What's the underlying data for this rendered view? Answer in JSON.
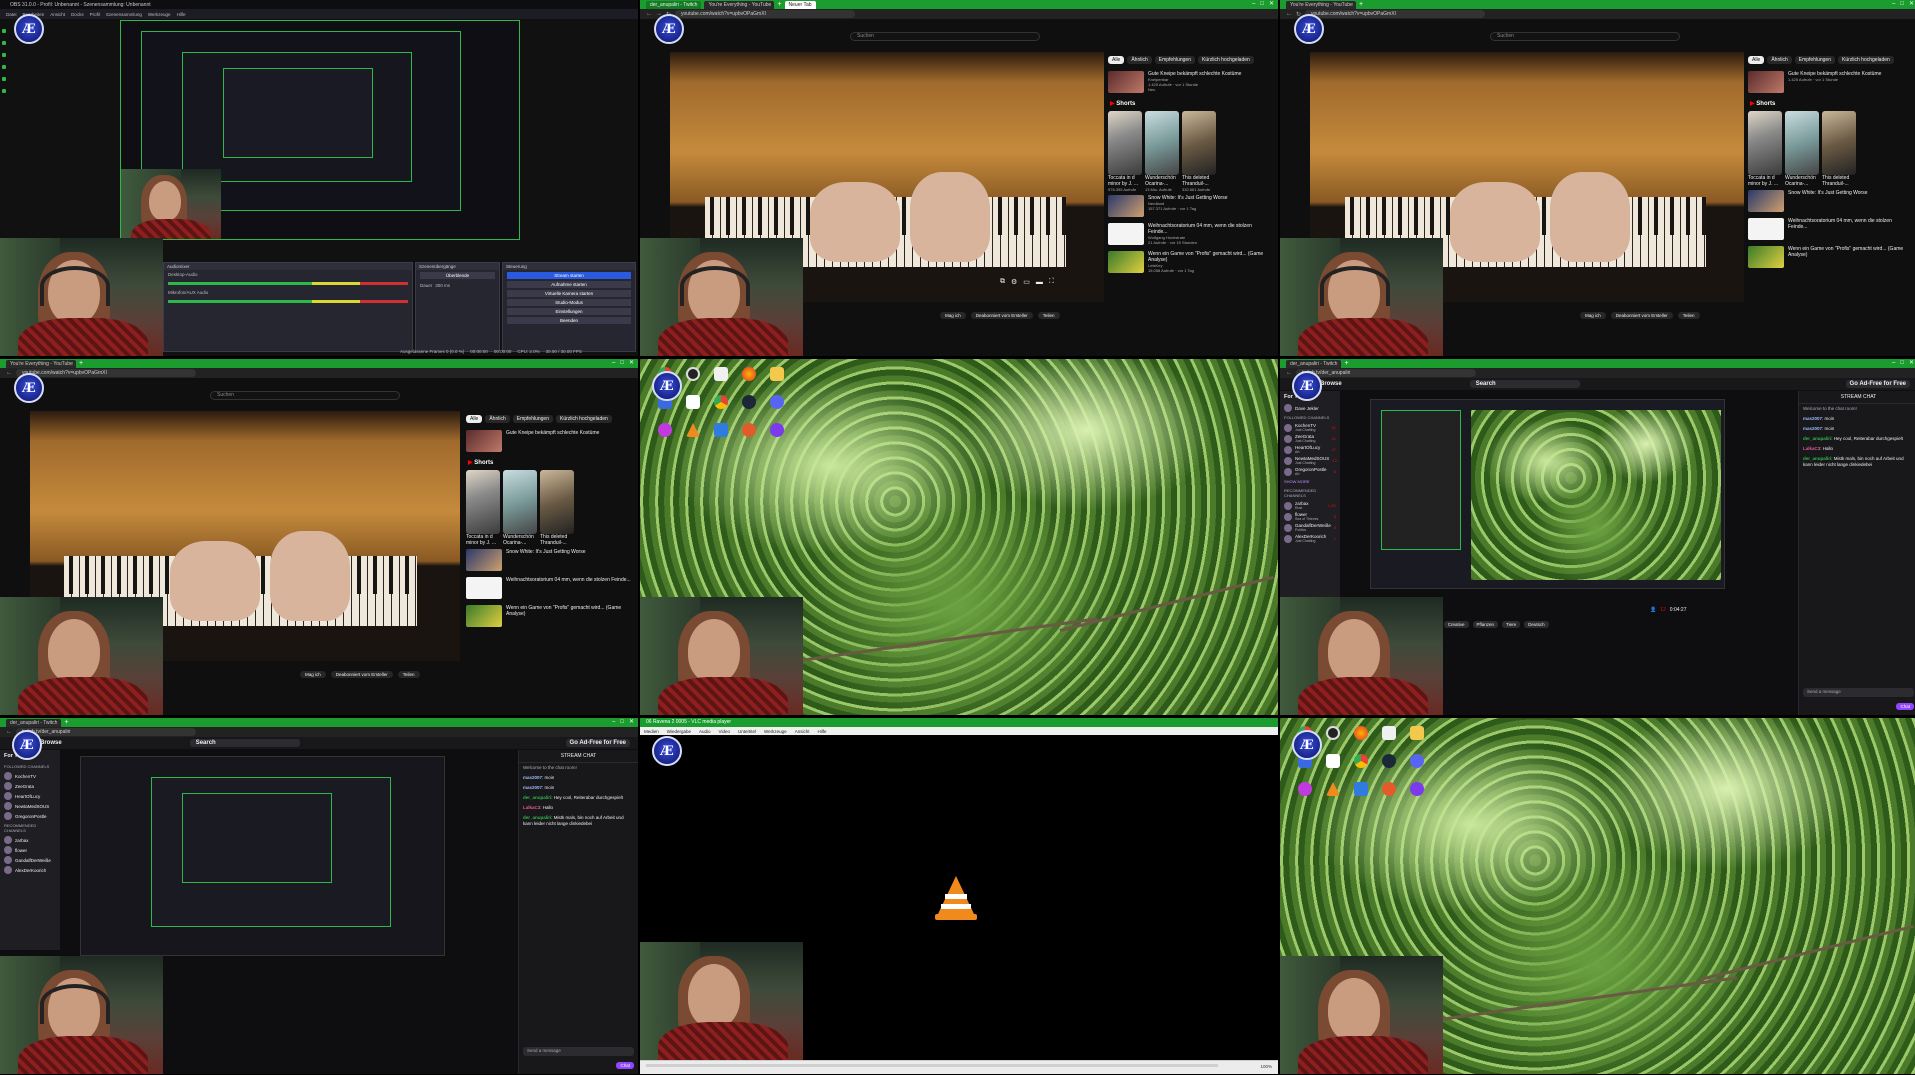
{
  "logo_glyph": "Æ",
  "tile1": {
    "window_title": "OBS 31.0.0 - Profil: Unbenannt - Szenensammlung: Unbenannt",
    "menu": [
      "Datei",
      "Bearbeiten",
      "Ansicht",
      "Docks",
      "Profil",
      "Szenensammlung",
      "Werkzeuge",
      "Hilfe"
    ],
    "audio_mixer_title": "Audiomixer",
    "audio_tracks": [
      "Desktop-Audio",
      "Mikrofon/AUX Audio"
    ],
    "transitions_title": "Szenenübergänge",
    "transition_value": "Überblende",
    "duration_label": "Dauer",
    "duration_value": "300 ms",
    "controls_title": "Steuerung",
    "controls": [
      "Stream starten",
      "Aufnahme starten",
      "Virtuelle Kamera starten",
      "Studio-Modus",
      "Einstellungen",
      "Beenden"
    ],
    "status": [
      "Ausgelassene Frames 0 (0.0 %)",
      "00:00:00",
      "00:00:00",
      "CPU: 2.0%",
      "30.00 / 30.00 FPS"
    ]
  },
  "yt": {
    "tabs": [
      "der_anupaliri - Twitch",
      "You're Everything - YouTube"
    ],
    "tab_single": "You're Everything - YouTube",
    "new_tab_tooltip": "Neuer Tab",
    "url": "youtube.com/watch?v=upbvOPaGmXI",
    "search_placeholder": "Suchen",
    "chips": [
      "Alle",
      "Ähnlich",
      "Empfehlungen",
      "Kürzlich hochgeladen"
    ],
    "rec1_title": "Gute Kneipe bekämpft schlechte Kostüme",
    "rec1_channel": "Kneipenbar",
    "rec1_meta": "1.425 Aufrufe · vor 1 Stunde",
    "rec1_badge": "Neu",
    "shorts_title": "Shorts",
    "shorts": [
      {
        "title": "Toccata in d minor by J. ...",
        "views": "976.395 Aufrufe"
      },
      {
        "title": "Wunderschön Ocarina-...",
        "views": "13 Mio. Aufrufe"
      },
      {
        "title": "This deleted Thranduil-...",
        "views": "332.661 Aufrufe"
      }
    ],
    "rec2_title": "Snow White: It's Just Getting Worse",
    "rec2_channel": "Nerdland",
    "rec2_meta": "157.371 Aufrufe · vor 1 Tag",
    "rec3_title": "Weihnachtsoratorium 04 mm, wenn die stolzen Feinde...",
    "rec3_channel": "Wolfgang Hochstrate",
    "rec3_meta": "21 Aufrufe · vor 15 Stunden",
    "rec4_title": "Wenn ein Game von \"Profis\" gemacht wird... (Game Analyse)",
    "rec4_channel": "LetsKey",
    "rec4_meta": "15.058 Aufrufe · vor 1 Tag",
    "actions": [
      "Mag ich",
      "Deabonniert vom Ersteller",
      "Teilen"
    ]
  },
  "twitch": {
    "tab": "der_anupaliri - Twitch",
    "url": "twitch.tv/der_anupaliri",
    "browse": "Browse",
    "search_placeholder": "Search",
    "ad_free": "Go Ad-Free for Free",
    "for_you": "For You",
    "user": "Dave Jekler",
    "followed": "FOLLOWED CHANNELS",
    "channels": [
      {
        "name": "KochenTV",
        "game": "Just Chatting",
        "viewers": "61"
      },
      {
        "name": "ZeeGrata",
        "game": "Just Chatting",
        "viewers": "41"
      },
      {
        "name": "HeartOfLucy",
        "game": "Art",
        "viewers": "27"
      },
      {
        "name": "NewtaMedSOUS",
        "game": "Just Chatting",
        "viewers": "13"
      },
      {
        "name": "GregoronPostle",
        "game": "Art",
        "viewers": "6"
      }
    ],
    "show_more": "Show More",
    "recommended": "RECOMMENDED CHANNELS",
    "rec_channels": [
      {
        "name": "zarbax",
        "game": "Rust",
        "viewers": "1,3K"
      },
      {
        "name": "flower",
        "game": "Sea of Thieves",
        "viewers": "8"
      },
      {
        "name": "GandalfDerWeiße",
        "game": "Politics",
        "viewers": "5"
      },
      {
        "name": "AlexDerKoorich",
        "game": "Just Chatting",
        "viewers": "1"
      }
    ],
    "chat_title": "STREAM CHAT",
    "chat_welcome": "Welcome to the chat room!",
    "messages": [
      {
        "user": "mas2007",
        "text": "moin"
      },
      {
        "user": "mas2007",
        "text": "moin"
      },
      {
        "user": "der_anupaliri",
        "text": "Hey cool, Reiterabar durchgespielt"
      },
      {
        "user": "LalkaC3",
        "text": "Hallo"
      },
      {
        "user": "der_anupaliri",
        "text": "Mistk mals, bin noch auf Arbeit und kann leider nicht lange dinkiedebei"
      }
    ],
    "send_placeholder": "Send a message",
    "chat_button": "Chat",
    "viewers": "12",
    "uptime": "0:04:27",
    "tags": [
      "Music",
      "Creative",
      "Pflanzen",
      "Tiere",
      "Deutsch"
    ]
  },
  "vlc": {
    "title": "06 Ravena 2 0005 - VLC media player",
    "menu": [
      "Medien",
      "Wiedergabe",
      "Audio",
      "Video",
      "Untertitel",
      "Werkzeuge",
      "Ansicht",
      "Hilfe"
    ],
    "volume": "100%"
  },
  "desktop": {
    "icons": [
      "chrome",
      "obs",
      "vlc",
      "discord",
      "folder",
      "steam",
      "firefox",
      "music",
      "files",
      "settings"
    ]
  }
}
